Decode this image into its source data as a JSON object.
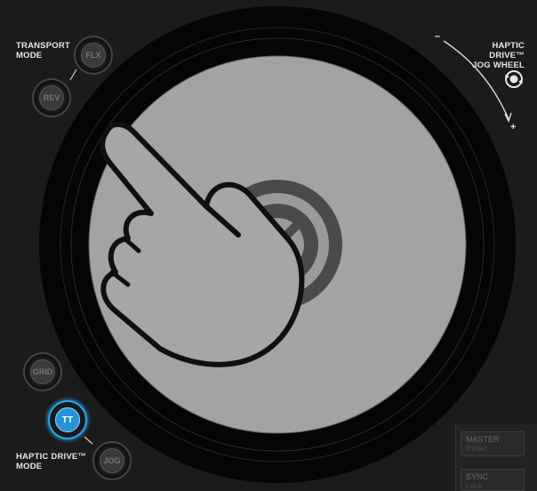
{
  "transport": {
    "label_line1": "TRANSPORT",
    "label_line2": "MODE",
    "flx_label": "FLX",
    "rev_label": "REV"
  },
  "haptic_mode": {
    "label_line1": "HAPTIC DRIVE™",
    "label_line2": "MODE",
    "grid_label": "GRID",
    "tt_label": "TT",
    "jog_label": "JOG"
  },
  "jog_wheel": {
    "label_line1": "HAPTIC DRIVE™",
    "label_line2": "JOG WHEEL",
    "minus": "–",
    "plus": "+"
  },
  "side_buttons": {
    "master_label": "MASTER",
    "master_sub": "Reset",
    "sync_label": "SYNC",
    "sync_sub": "Lock"
  },
  "colors": {
    "accent": "#2793d6",
    "platter": "#a3a3a3",
    "hand": "#a6a6a6"
  }
}
